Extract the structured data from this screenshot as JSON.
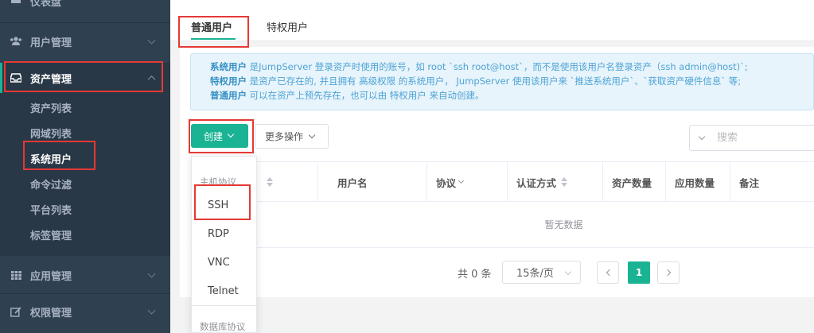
{
  "sidebar": {
    "items": [
      {
        "label": "仪表盘",
        "icon": "dashboard-icon"
      },
      {
        "label": "用户管理",
        "icon": "users-icon"
      },
      {
        "label": "资产管理",
        "icon": "inbox-icon"
      },
      {
        "label": "应用管理",
        "icon": "grid-icon"
      },
      {
        "label": "权限管理",
        "icon": "edit-icon"
      }
    ],
    "asset_submenu": [
      "资产列表",
      "网域列表",
      "系统用户",
      "命令过滤",
      "平台列表",
      "标签管理"
    ]
  },
  "tabs": [
    "普通用户",
    "特权用户"
  ],
  "alert": {
    "line1_bold": "系统用户",
    "line1": " 是JumpServer 登录资产时使用的账号，如 root `ssh root@host`，而不是使用该用户名登录资产（ssh admin@host)`;",
    "line2_bold": "特权用户",
    "line2": " 是资产已存在的, 并且拥有 高级权限 的系统用户， JumpServer 使用该用户来 `推送系统用户`、`获取资产硬件信息` 等;",
    "line3_bold": "普通用户",
    "line3": " 可以在资产上预先存在，也可以由 特权用户 来自动创建。"
  },
  "toolbar": {
    "create_label": "创建",
    "more_label": "更多操作",
    "search_placeholder": "搜索"
  },
  "table": {
    "columns": [
      "用户名",
      "协议",
      "认证方式",
      "资产数量",
      "应用数量",
      "备注"
    ],
    "empty_text": "暂无数据"
  },
  "pagination": {
    "total": "共 0 条",
    "page_size": "15条/页",
    "current_page": "1"
  },
  "dropdown": {
    "group1": "主机协议",
    "items": [
      "SSH",
      "RDP",
      "VNC",
      "Telnet"
    ],
    "group2": "数据库协议"
  },
  "colors": {
    "sidebar_bg": "#2f4050",
    "accent": "#1ab394",
    "highlight": "#e53935",
    "alert_text": "#4ca3d6"
  }
}
